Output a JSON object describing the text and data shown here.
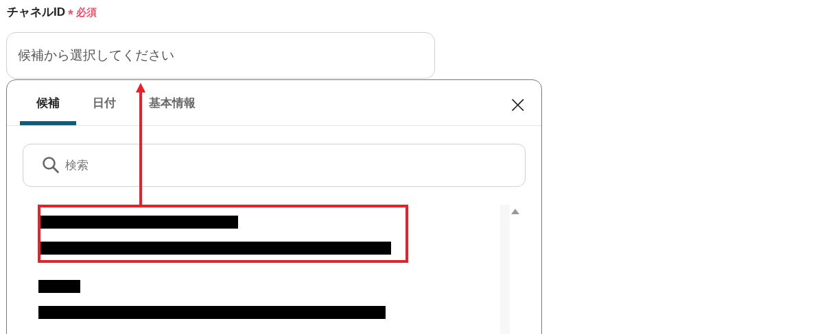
{
  "field": {
    "label": "チャネルID",
    "required_mark": "*",
    "required": "必須",
    "placeholder": "候補から選択してください"
  },
  "popup": {
    "tabs": [
      {
        "label": "候補",
        "selected": true
      },
      {
        "label": "日付",
        "selected": false
      },
      {
        "label": "基本情報",
        "selected": false
      }
    ],
    "close": "×",
    "search": {
      "placeholder": "検索"
    },
    "candidates": [
      {
        "kind": "redacted",
        "highlighted": true
      },
      {
        "kind": "redacted",
        "highlighted": false
      }
    ]
  }
}
